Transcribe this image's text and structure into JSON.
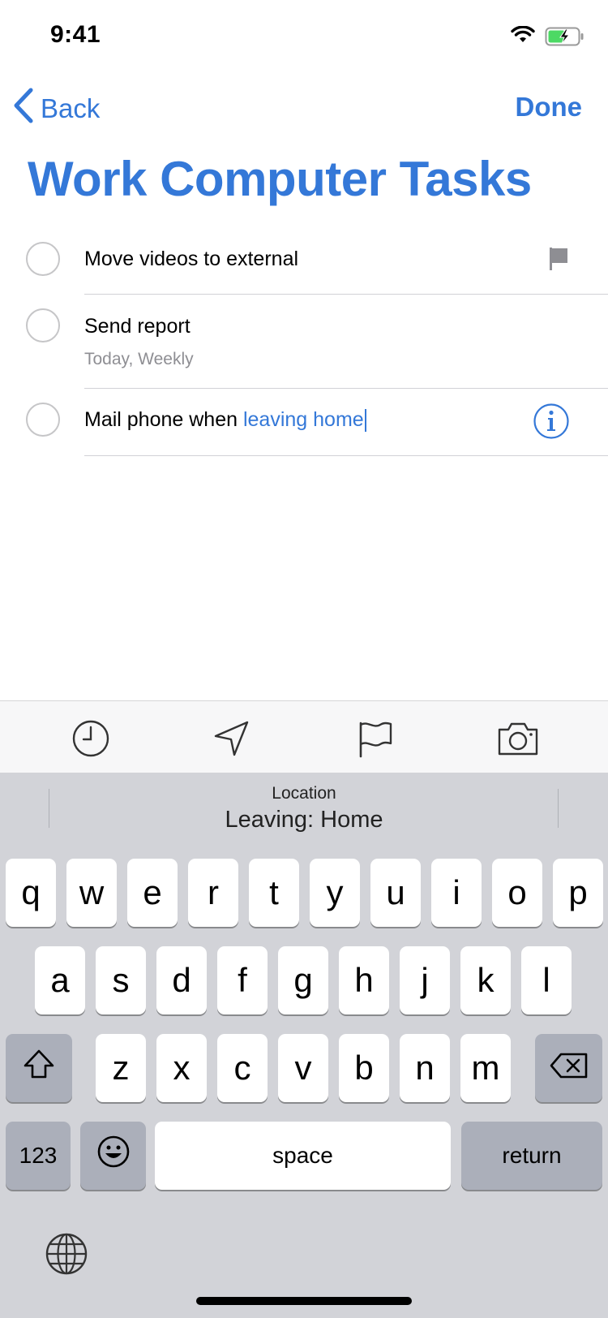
{
  "status_bar": {
    "time": "9:41"
  },
  "nav": {
    "back_label": "Back",
    "done_label": "Done"
  },
  "list": {
    "title": "Work Computer Tasks",
    "items": [
      {
        "text": "Move videos to external",
        "flagged": true
      },
      {
        "text": "Send report",
        "subtitle": "Today, Weekly"
      },
      {
        "text": "Mail phone when ",
        "location_text": "leaving home",
        "editing": true
      }
    ]
  },
  "toolbar": {
    "icons": [
      "clock-icon",
      "location-arrow-icon",
      "flag-icon",
      "camera-icon"
    ]
  },
  "keyboard": {
    "suggestion": {
      "category": "Location",
      "value": "Leaving: Home"
    },
    "row1": [
      "q",
      "w",
      "e",
      "r",
      "t",
      "y",
      "u",
      "i",
      "o",
      "p"
    ],
    "row2": [
      "a",
      "s",
      "d",
      "f",
      "g",
      "h",
      "j",
      "k",
      "l"
    ],
    "row3": [
      "z",
      "x",
      "c",
      "v",
      "b",
      "n",
      "m"
    ],
    "numbers_label": "123",
    "space_label": "space",
    "return_label": "return"
  },
  "colors": {
    "accent": "#3478d8",
    "keyboard_bg": "#d2d3d8",
    "key_dark": "#abafba"
  }
}
